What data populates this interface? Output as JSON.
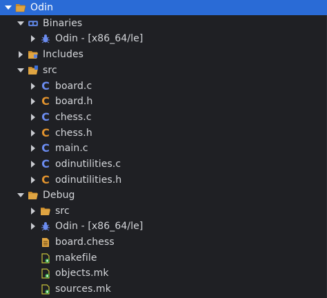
{
  "tree": {
    "project": {
      "label": "Odin",
      "icon": "project-folder-icon"
    },
    "binaries": {
      "label": "Binaries",
      "icon": "binaries-icon"
    },
    "binaries_odin": {
      "label": "Odin - [x86_64/le]",
      "icon": "bug-executable-icon"
    },
    "includes": {
      "label": "Includes",
      "icon": "includes-folder-icon"
    },
    "src": {
      "label": "src",
      "icon": "source-folder-icon"
    },
    "board_c": {
      "label": "board.c",
      "icon": "c-source-file-icon"
    },
    "board_h": {
      "label": "board.h",
      "icon": "c-header-file-icon"
    },
    "chess_c": {
      "label": "chess.c",
      "icon": "c-source-file-icon"
    },
    "chess_h": {
      "label": "chess.h",
      "icon": "c-header-file-icon"
    },
    "main_c": {
      "label": "main.c",
      "icon": "c-source-file-icon"
    },
    "odinutilities_c": {
      "label": "odinutilities.c",
      "icon": "c-source-file-icon"
    },
    "odinutilities_h": {
      "label": "odinutilities.h",
      "icon": "c-header-file-icon"
    },
    "debug": {
      "label": "Debug",
      "icon": "folder-open-icon"
    },
    "debug_src": {
      "label": "src",
      "icon": "folder-open-icon"
    },
    "debug_odin": {
      "label": "Odin - [x86_64/le]",
      "icon": "bug-executable-icon"
    },
    "board_chess": {
      "label": "board.chess",
      "icon": "text-file-icon"
    },
    "makefile": {
      "label": "makefile",
      "icon": "make-file-icon"
    },
    "objects_mk": {
      "label": "objects.mk",
      "icon": "make-file-icon"
    },
    "sources_mk": {
      "label": "sources.mk",
      "icon": "make-file-icon"
    }
  },
  "colors": {
    "background": "#1f2024",
    "selection": "#2a6bd6",
    "folder": "#e0a542",
    "c_source": "#6b8cf0",
    "c_header": "#e0922e",
    "text": "#d4d6da"
  }
}
